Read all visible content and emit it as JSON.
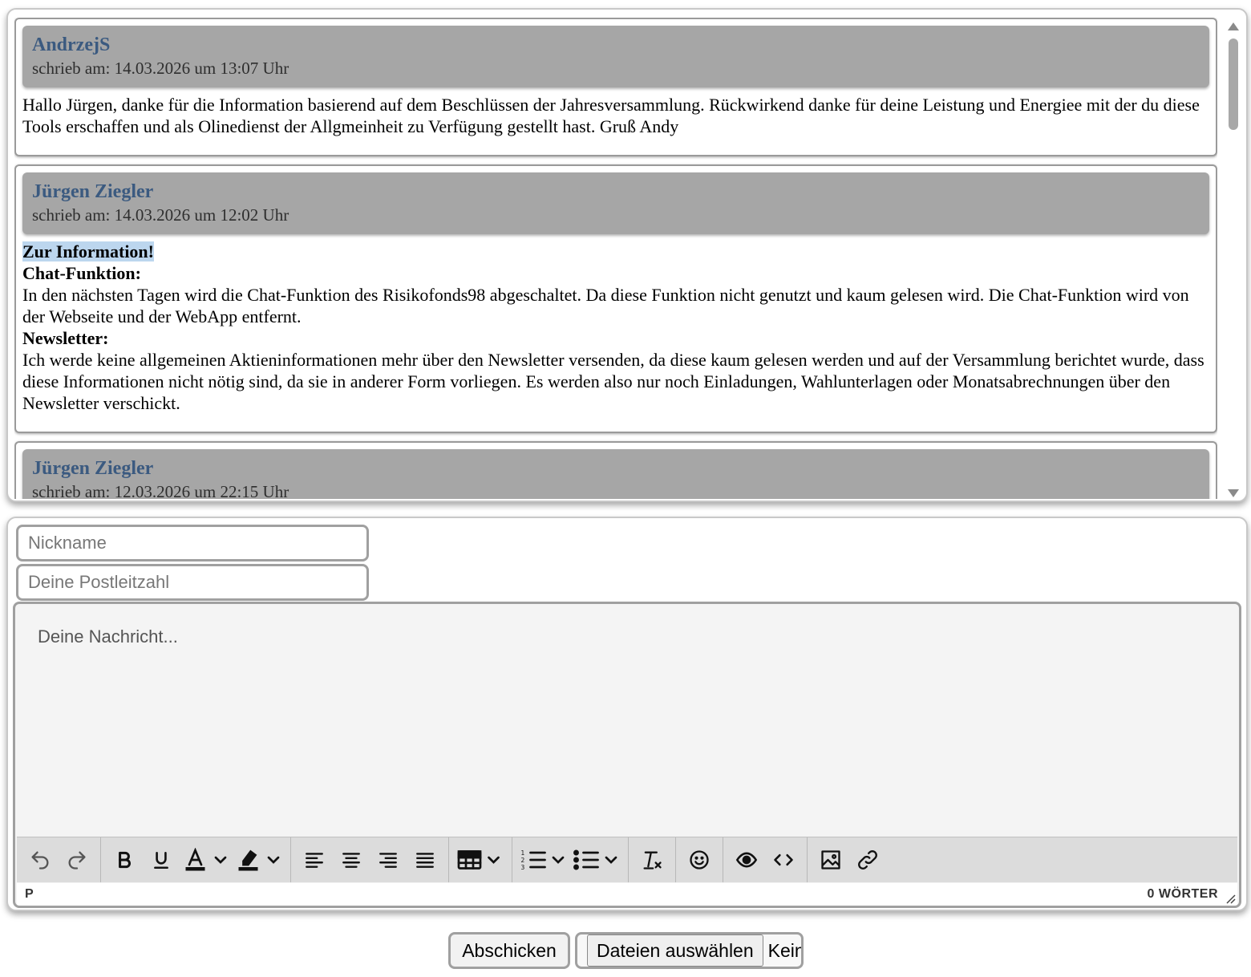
{
  "posts": [
    {
      "author": "AndrzejS",
      "meta": "schrieb am: 14.03.2026 um 13:07 Uhr",
      "body": "Hallo Jürgen, danke für die Information basierend auf dem Beschlüssen der Jahresversammlung. Rückwirkend danke für deine Leistung und Energiee mit der du diese Tools erschaffen und als Olinedienst der Allgmeinheit zu Verfügung gestellt hast. Gruß Andy"
    },
    {
      "author": "Jürgen Ziegler",
      "meta": "schrieb am: 14.03.2026 um 12:02 Uhr",
      "heading": "Zur Information!",
      "section1_title": "Chat-Funktion:",
      "section1_text": "In den nächsten Tagen wird die Chat-Funktion des Risikofonds98 abgeschaltet. Da diese Funktion nicht genutzt und kaum gelesen wird. Die Chat-Funktion wird von der Webseite und der WebApp entfernt.",
      "section2_title": "Newsletter:",
      "section2_text": "Ich werde keine allgemeinen Aktieninformationen mehr über den Newsletter versenden, da diese kaum gelesen werden und auf der Versammlung berichtet wurde, dass diese Informationen nicht nötig sind, da sie in anderer Form vorliegen. Es werden also nur noch Einladungen, Wahlunterlagen oder Monatsabrechnungen über den Newsletter verschickt."
    },
    {
      "author": "Jürgen Ziegler",
      "meta": "schrieb am: 12.03.2026 um 22:15 Uhr"
    }
  ],
  "form": {
    "nickname_placeholder": "Nickname",
    "zip_placeholder": "Deine Postleitzahl",
    "message_placeholder": "Deine Nachricht...",
    "status_path": "P",
    "word_count": "0 WÖRTER",
    "submit_label": "Abschicken",
    "file_button_label": "Dateien auswählen",
    "file_status": "Keine ausgewählt"
  },
  "toolbar": {
    "groups": [
      [
        "undo-icon",
        "redo-icon"
      ],
      [
        "bold-icon",
        "underline-icon",
        "text-color-icon",
        "highlight-icon"
      ],
      [
        "align-left-icon",
        "align-center-icon",
        "align-right-icon",
        "align-justify-icon"
      ],
      [
        "table-icon"
      ],
      [
        "numbered-list-icon",
        "bullet-list-icon"
      ],
      [
        "clear-format-icon"
      ],
      [
        "emoji-icon"
      ],
      [
        "preview-icon",
        "source-code-icon"
      ],
      [
        "image-icon",
        "link-icon"
      ]
    ]
  },
  "colors": {
    "author": "#3b5a80",
    "header_bg": "#a6a6a6",
    "highlight": "#bcd6ee"
  }
}
